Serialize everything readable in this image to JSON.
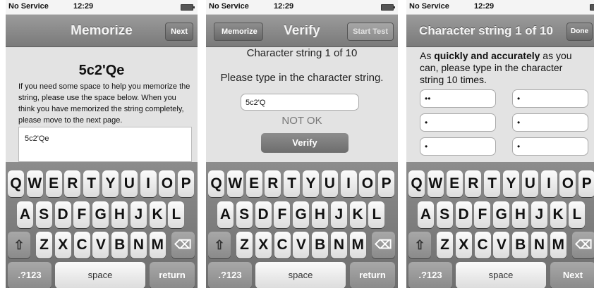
{
  "status_bar": {
    "carrier": "No Service",
    "time": "12:29"
  },
  "screen1": {
    "nav_title": "Memorize",
    "next_label": "Next",
    "string": "5c2'Qe",
    "instructions": "If you need some space to help you memorize the string, please use the space below. When you think you have memorized the string completely, please move to the next page.",
    "notes_value": "5c2'Qe"
  },
  "screen2": {
    "nav_title": "Verify",
    "back_label": "Memorize",
    "start_label": "Start Test",
    "header": "Character string 1 of 10",
    "prompt": "Please type in the character string.",
    "input_value": "5c2'Q",
    "status": "NOT OK",
    "verify_label": "Verify"
  },
  "screen3": {
    "nav_title": "Character string 1 of 10",
    "done_label": "Done",
    "instr_before": "As ",
    "instr_bold": "quickly and accurately",
    "instr_after": " as you can, please type in the character string 10 times.",
    "fields": [
      "••",
      "•",
      "•",
      "•",
      "•",
      "•"
    ]
  },
  "keyboard": {
    "row1": [
      "Q",
      "W",
      "E",
      "R",
      "T",
      "Y",
      "U",
      "I",
      "O",
      "P"
    ],
    "row2": [
      "A",
      "S",
      "D",
      "F",
      "G",
      "H",
      "J",
      "K",
      "L"
    ],
    "row3": [
      "Z",
      "X",
      "C",
      "V",
      "B",
      "N",
      "M"
    ],
    "numbers_label": ".?123",
    "space_label": "space",
    "return_label": "return",
    "next_label": "Next"
  }
}
